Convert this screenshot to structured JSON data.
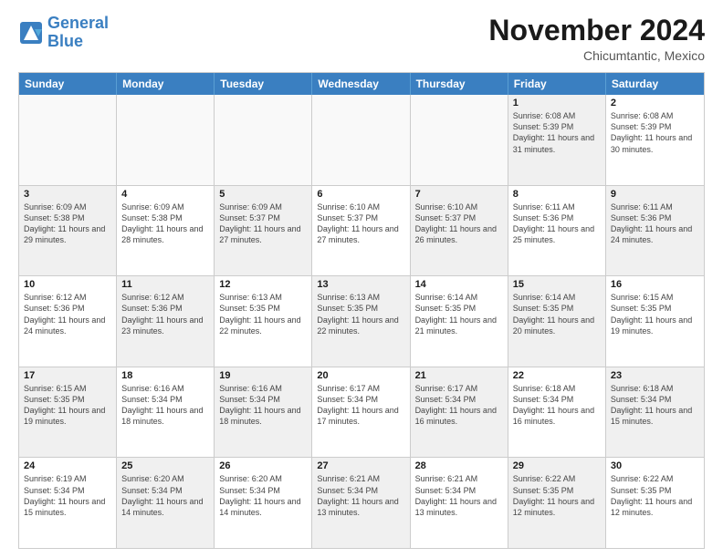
{
  "logo": {
    "line1": "General",
    "line2": "Blue"
  },
  "title": "November 2024",
  "location": "Chicumtantic, Mexico",
  "weekdays": [
    "Sunday",
    "Monday",
    "Tuesday",
    "Wednesday",
    "Thursday",
    "Friday",
    "Saturday"
  ],
  "rows": [
    [
      {
        "day": "",
        "info": "",
        "empty": true
      },
      {
        "day": "",
        "info": "",
        "empty": true
      },
      {
        "day": "",
        "info": "",
        "empty": true
      },
      {
        "day": "",
        "info": "",
        "empty": true
      },
      {
        "day": "",
        "info": "",
        "empty": true
      },
      {
        "day": "1",
        "info": "Sunrise: 6:08 AM\nSunset: 5:39 PM\nDaylight: 11 hours and 31 minutes.",
        "shaded": true
      },
      {
        "day": "2",
        "info": "Sunrise: 6:08 AM\nSunset: 5:39 PM\nDaylight: 11 hours and 30 minutes.",
        "shaded": false
      }
    ],
    [
      {
        "day": "3",
        "info": "Sunrise: 6:09 AM\nSunset: 5:38 PM\nDaylight: 11 hours and 29 minutes.",
        "shaded": true
      },
      {
        "day": "4",
        "info": "Sunrise: 6:09 AM\nSunset: 5:38 PM\nDaylight: 11 hours and 28 minutes.",
        "shaded": false
      },
      {
        "day": "5",
        "info": "Sunrise: 6:09 AM\nSunset: 5:37 PM\nDaylight: 11 hours and 27 minutes.",
        "shaded": true
      },
      {
        "day": "6",
        "info": "Sunrise: 6:10 AM\nSunset: 5:37 PM\nDaylight: 11 hours and 27 minutes.",
        "shaded": false
      },
      {
        "day": "7",
        "info": "Sunrise: 6:10 AM\nSunset: 5:37 PM\nDaylight: 11 hours and 26 minutes.",
        "shaded": true
      },
      {
        "day": "8",
        "info": "Sunrise: 6:11 AM\nSunset: 5:36 PM\nDaylight: 11 hours and 25 minutes.",
        "shaded": false
      },
      {
        "day": "9",
        "info": "Sunrise: 6:11 AM\nSunset: 5:36 PM\nDaylight: 11 hours and 24 minutes.",
        "shaded": true
      }
    ],
    [
      {
        "day": "10",
        "info": "Sunrise: 6:12 AM\nSunset: 5:36 PM\nDaylight: 11 hours and 24 minutes.",
        "shaded": false
      },
      {
        "day": "11",
        "info": "Sunrise: 6:12 AM\nSunset: 5:36 PM\nDaylight: 11 hours and 23 minutes.",
        "shaded": true
      },
      {
        "day": "12",
        "info": "Sunrise: 6:13 AM\nSunset: 5:35 PM\nDaylight: 11 hours and 22 minutes.",
        "shaded": false
      },
      {
        "day": "13",
        "info": "Sunrise: 6:13 AM\nSunset: 5:35 PM\nDaylight: 11 hours and 22 minutes.",
        "shaded": true
      },
      {
        "day": "14",
        "info": "Sunrise: 6:14 AM\nSunset: 5:35 PM\nDaylight: 11 hours and 21 minutes.",
        "shaded": false
      },
      {
        "day": "15",
        "info": "Sunrise: 6:14 AM\nSunset: 5:35 PM\nDaylight: 11 hours and 20 minutes.",
        "shaded": true
      },
      {
        "day": "16",
        "info": "Sunrise: 6:15 AM\nSunset: 5:35 PM\nDaylight: 11 hours and 19 minutes.",
        "shaded": false
      }
    ],
    [
      {
        "day": "17",
        "info": "Sunrise: 6:15 AM\nSunset: 5:35 PM\nDaylight: 11 hours and 19 minutes.",
        "shaded": true
      },
      {
        "day": "18",
        "info": "Sunrise: 6:16 AM\nSunset: 5:34 PM\nDaylight: 11 hours and 18 minutes.",
        "shaded": false
      },
      {
        "day": "19",
        "info": "Sunrise: 6:16 AM\nSunset: 5:34 PM\nDaylight: 11 hours and 18 minutes.",
        "shaded": true
      },
      {
        "day": "20",
        "info": "Sunrise: 6:17 AM\nSunset: 5:34 PM\nDaylight: 11 hours and 17 minutes.",
        "shaded": false
      },
      {
        "day": "21",
        "info": "Sunrise: 6:17 AM\nSunset: 5:34 PM\nDaylight: 11 hours and 16 minutes.",
        "shaded": true
      },
      {
        "day": "22",
        "info": "Sunrise: 6:18 AM\nSunset: 5:34 PM\nDaylight: 11 hours and 16 minutes.",
        "shaded": false
      },
      {
        "day": "23",
        "info": "Sunrise: 6:18 AM\nSunset: 5:34 PM\nDaylight: 11 hours and 15 minutes.",
        "shaded": true
      }
    ],
    [
      {
        "day": "24",
        "info": "Sunrise: 6:19 AM\nSunset: 5:34 PM\nDaylight: 11 hours and 15 minutes.",
        "shaded": false
      },
      {
        "day": "25",
        "info": "Sunrise: 6:20 AM\nSunset: 5:34 PM\nDaylight: 11 hours and 14 minutes.",
        "shaded": true
      },
      {
        "day": "26",
        "info": "Sunrise: 6:20 AM\nSunset: 5:34 PM\nDaylight: 11 hours and 14 minutes.",
        "shaded": false
      },
      {
        "day": "27",
        "info": "Sunrise: 6:21 AM\nSunset: 5:34 PM\nDaylight: 11 hours and 13 minutes.",
        "shaded": true
      },
      {
        "day": "28",
        "info": "Sunrise: 6:21 AM\nSunset: 5:34 PM\nDaylight: 11 hours and 13 minutes.",
        "shaded": false
      },
      {
        "day": "29",
        "info": "Sunrise: 6:22 AM\nSunset: 5:35 PM\nDaylight: 11 hours and 12 minutes.",
        "shaded": true
      },
      {
        "day": "30",
        "info": "Sunrise: 6:22 AM\nSunset: 5:35 PM\nDaylight: 11 hours and 12 minutes.",
        "shaded": false
      }
    ]
  ]
}
